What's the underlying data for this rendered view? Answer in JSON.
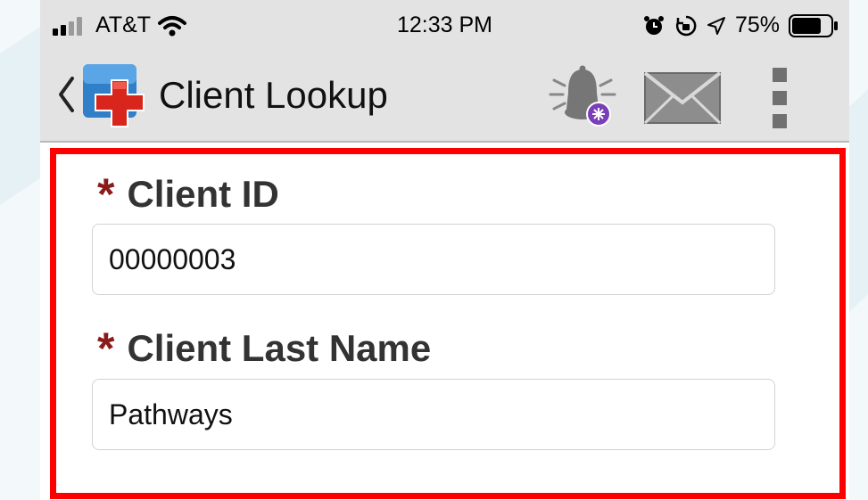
{
  "status_bar": {
    "carrier": "AT&T",
    "time": "12:33 PM",
    "battery": "75%",
    "icons": [
      "signal-icon",
      "wifi-icon",
      "alarm-icon",
      "orientation-lock-icon",
      "location-icon",
      "battery-icon"
    ]
  },
  "nav": {
    "title": "Client Lookup",
    "icons": [
      "back-chevron-icon",
      "app-logo-icon",
      "notification-bell-icon",
      "mail-icon",
      "more-vertical-icon"
    ]
  },
  "form": {
    "client_id": {
      "label": "Client ID",
      "required_mark": "*",
      "value": "00000003"
    },
    "client_last_name": {
      "label": "Client Last Name",
      "required_mark": "*",
      "value": "Pathways"
    }
  },
  "colors": {
    "highlight_border": "#ff0000",
    "required_star": "#8b1a1a",
    "bar_background": "#e3e3e3",
    "notification_badge": "#7a3fb8"
  }
}
